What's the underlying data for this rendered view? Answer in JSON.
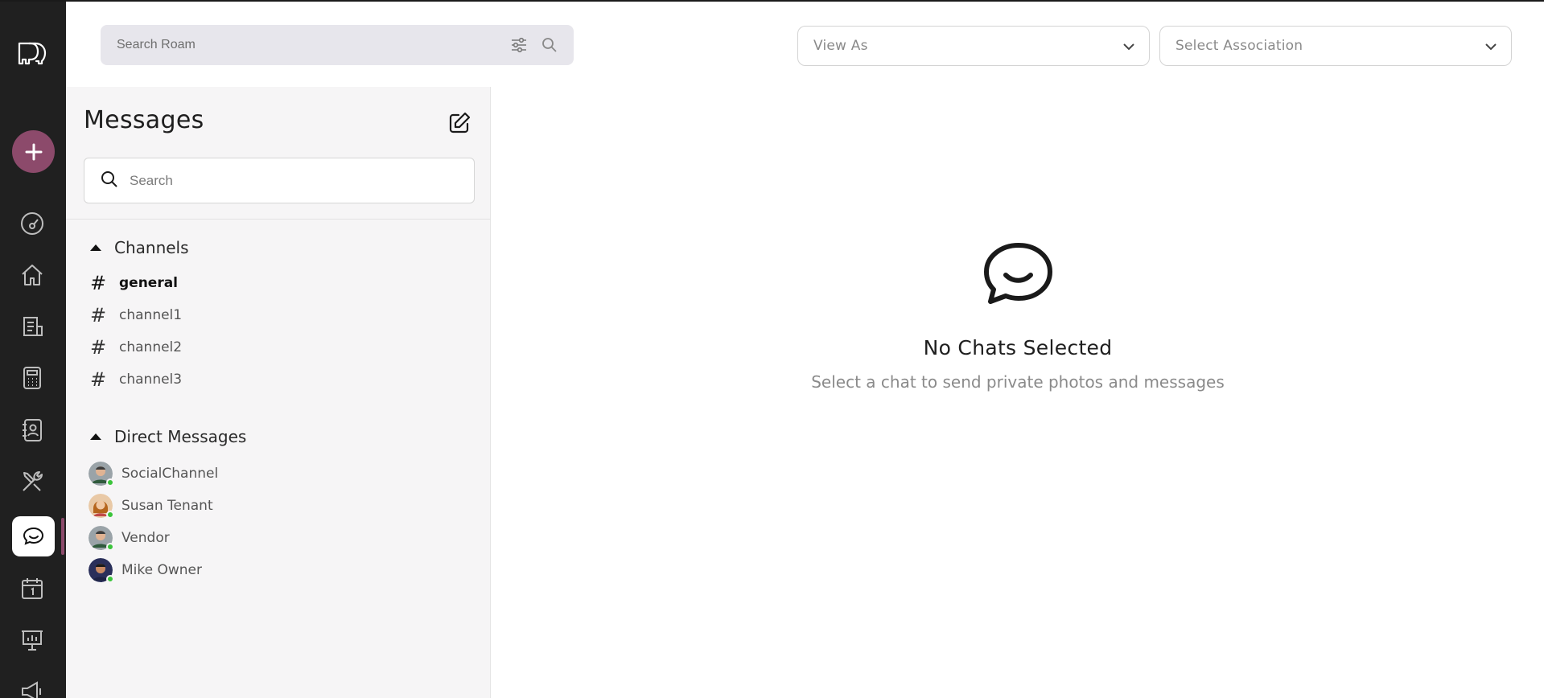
{
  "topbar": {
    "search_placeholder": "Search Roam",
    "view_as_label": "View As",
    "association_label": "Select Association"
  },
  "rail": {
    "items": [
      {
        "icon": "dashboard-icon"
      },
      {
        "icon": "home-icon"
      },
      {
        "icon": "ledger-icon"
      },
      {
        "icon": "calculator-icon"
      },
      {
        "icon": "contacts-icon"
      },
      {
        "icon": "tools-icon"
      },
      {
        "icon": "chat-icon",
        "active": true
      },
      {
        "icon": "calendar-icon"
      },
      {
        "icon": "presentation-icon"
      },
      {
        "icon": "megaphone-icon"
      }
    ],
    "accent_color": "#8c4a6b"
  },
  "messages": {
    "title": "Messages",
    "search_placeholder": "Search",
    "channels_header": "Channels",
    "channels": [
      {
        "name": "general",
        "bold": true
      },
      {
        "name": "channel1"
      },
      {
        "name": "channel2"
      },
      {
        "name": "channel3"
      }
    ],
    "dm_header": "Direct Messages",
    "direct_messages": [
      {
        "name": "SocialChannel",
        "online": true
      },
      {
        "name": "Susan Tenant",
        "online": true
      },
      {
        "name": "Vendor",
        "online": true
      },
      {
        "name": "Mike Owner",
        "online": true
      }
    ]
  },
  "empty_state": {
    "title": "No Chats Selected",
    "subtitle": "Select a chat to send private photos and messages"
  }
}
